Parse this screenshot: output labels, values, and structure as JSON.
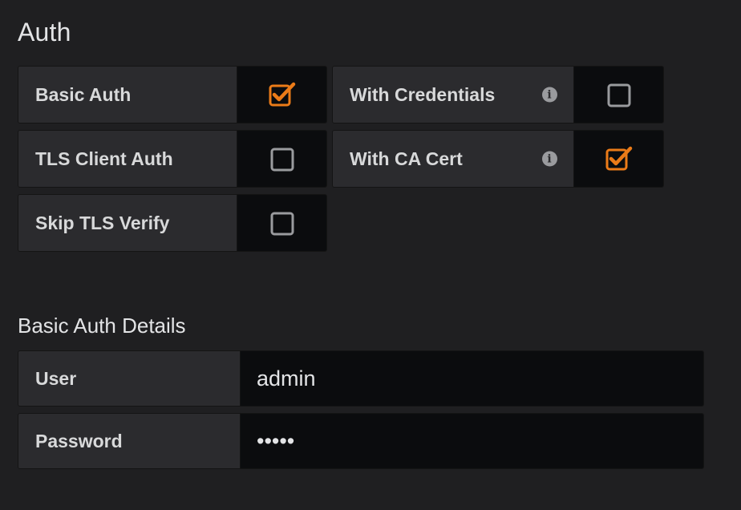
{
  "auth": {
    "title": "Auth",
    "toggles": [
      {
        "label": "Basic Auth",
        "checked": true,
        "info": false
      },
      {
        "label": "With Credentials",
        "checked": false,
        "info": true
      },
      {
        "label": "TLS Client Auth",
        "checked": false,
        "info": false
      },
      {
        "label": "With CA Cert",
        "checked": true,
        "info": true
      },
      {
        "label": "Skip TLS Verify",
        "checked": false,
        "info": false
      }
    ],
    "info_icon_glyph": "i"
  },
  "basic_auth_details": {
    "title": "Basic Auth Details",
    "user_label": "User",
    "user_value": "admin",
    "password_label": "Password",
    "password_value": "•••••"
  },
  "colors": {
    "accent": "#eb7b18",
    "unchecked_border": "#9a9b9e",
    "label_bg": "#2b2b2e",
    "input_bg": "#0b0c0e",
    "page_bg": "#1f1f21"
  },
  "icons": {
    "checked": "checkbox-checked-icon",
    "unchecked": "checkbox-unchecked-icon",
    "info": "info-circle-icon"
  }
}
